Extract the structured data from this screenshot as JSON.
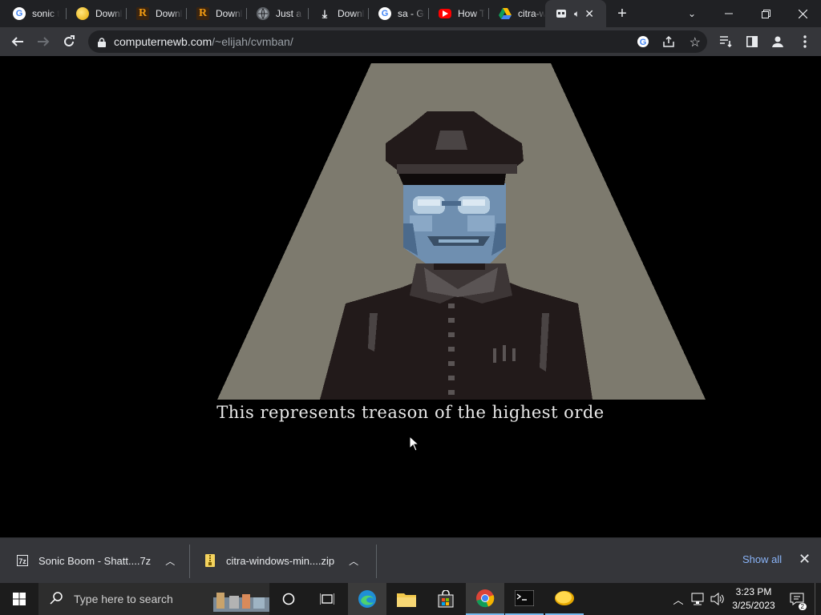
{
  "tabs": [
    {
      "title": "sonic t",
      "icon": "google-icon"
    },
    {
      "title": "Downl",
      "icon": "coin-icon"
    },
    {
      "title": "Downl",
      "icon": "r-logo-icon"
    },
    {
      "title": "Downl",
      "icon": "r-logo-icon"
    },
    {
      "title": "Just a",
      "icon": "globe-icon"
    },
    {
      "title": "Downl",
      "icon": "download-icon"
    },
    {
      "title": "sa - Gi",
      "icon": "google-icon"
    },
    {
      "title": "How T",
      "icon": "youtube-icon"
    },
    {
      "title": "citra-w",
      "icon": "google-drive-icon"
    },
    {
      "title": "",
      "icon": "game-icon",
      "active": true,
      "audio": "speaker-icon"
    }
  ],
  "toolbar": {
    "url_host": "computernewb.com",
    "url_path": "/~elijah/cvmban/"
  },
  "game": {
    "caption": "This represents treason of the highest orde"
  },
  "downloads": {
    "items": [
      {
        "name": "Sonic Boom - Shatt....7z",
        "icon": "archive-icon"
      },
      {
        "name": "citra-windows-min....zip",
        "icon": "zip-icon"
      }
    ],
    "show_all": "Show all"
  },
  "taskbar": {
    "search_placeholder": "Type here to search",
    "time": "3:23 PM",
    "date": "3/25/2023"
  },
  "colors": {
    "spotlight": "#7d7a6e",
    "uniform": "#221a1a",
    "face": "#6f8fb0",
    "accent_link": "#8ab4f8"
  }
}
